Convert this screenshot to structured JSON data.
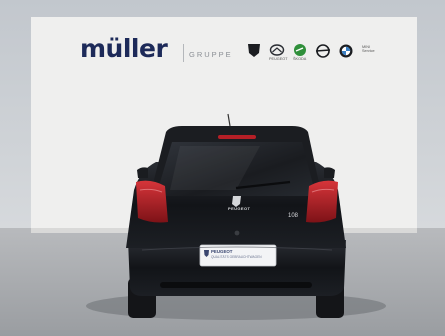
{
  "banner": {
    "brand_name": "müller",
    "group_label": "GRUPPE",
    "partner_logos": [
      "peugeot-logo",
      "mazda-logo",
      "skoda-logo",
      "opel-logo",
      "bmw-logo",
      "mini-logo"
    ],
    "partner_captions": {
      "peugeot": "PEUGEOT",
      "skoda": "ŠKODA",
      "mini": "MINI Service"
    }
  },
  "vehicle": {
    "badge": "PEUGEOT",
    "model": "108",
    "plate_line1": "PEUGEOT",
    "plate_line2": "QUALITÄTS GEBRAUCHTWAGEN"
  },
  "colors": {
    "brand_navy": "#1d2a59",
    "car_body": "#15171b",
    "tail_light": "#b51f26",
    "wall": "#eeeeed",
    "ground": "#a3a6aa"
  }
}
